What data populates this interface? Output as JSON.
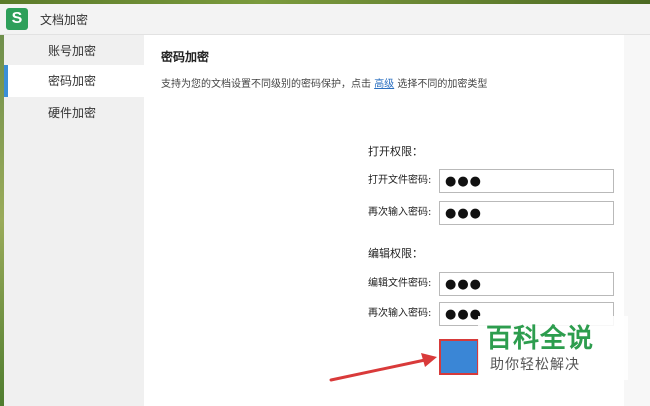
{
  "window": {
    "app_icon_letter": "S",
    "title": "文档加密"
  },
  "sidebar": {
    "items": [
      {
        "label": "账号加密",
        "active": false
      },
      {
        "label": "密码加密",
        "active": true
      },
      {
        "label": "硬件加密",
        "active": false
      }
    ]
  },
  "main": {
    "section_title": "密码加密",
    "description_prefix": "支持为您的文档设置不同级别的密码保护，点击",
    "description_link": "高级",
    "description_suffix": "选择不同的加密类型",
    "open_permission": {
      "title": "打开权限：",
      "password_label": "打开文件密码:",
      "password_value": "●●●",
      "confirm_label": "再次输入密码:",
      "confirm_value": "●●●"
    },
    "edit_permission": {
      "title": "编辑权限：",
      "password_label": "编辑文件密码:",
      "password_value": "●●●",
      "confirm_label": "再次输入密码:",
      "confirm_value": "●●●"
    }
  },
  "watermark": {
    "main": "百科全说",
    "sub": "助你轻松解决"
  },
  "colors": {
    "accent": "#3a86d6",
    "highlight_border": "#d63a3a",
    "brand_green": "#2d9d4e"
  }
}
